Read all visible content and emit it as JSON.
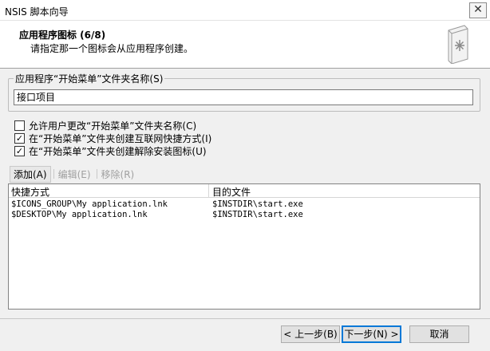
{
  "window": {
    "title": "NSIS 脚本向导",
    "close_symbol": "✕"
  },
  "header": {
    "title": "应用程序图标 (6/8)",
    "subtitle": "请指定那一个图标会从应用程序创建。",
    "icon": "wizard-book-icon"
  },
  "folder_group": {
    "label": "应用程序“开始菜单”文件夹名称(S)",
    "value": "接口项目"
  },
  "options": [
    {
      "label": "允许用户更改“开始菜单”文件夹名称(C)",
      "checked": false
    },
    {
      "label": "在“开始菜单”文件夹创建互联网快捷方式(I)",
      "checked": true
    },
    {
      "label": "在“开始菜单”文件夹创建解除安装图标(U)",
      "checked": true
    }
  ],
  "toolbar": {
    "add": "添加(A)",
    "edit": "编辑(E)",
    "remove": "移除(R)"
  },
  "shortcuts": {
    "columns": [
      "快捷方式",
      "目的文件"
    ],
    "rows": [
      {
        "shortcut": "$ICONS_GROUP\\My application.lnk",
        "target": "$INSTDIR\\start.exe"
      },
      {
        "shortcut": "$DESKTOP\\My application.lnk",
        "target": "$INSTDIR\\start.exe"
      }
    ]
  },
  "buttons": {
    "back": "< 上一步(B)",
    "next": "下一步(N) >",
    "cancel": "取消"
  }
}
